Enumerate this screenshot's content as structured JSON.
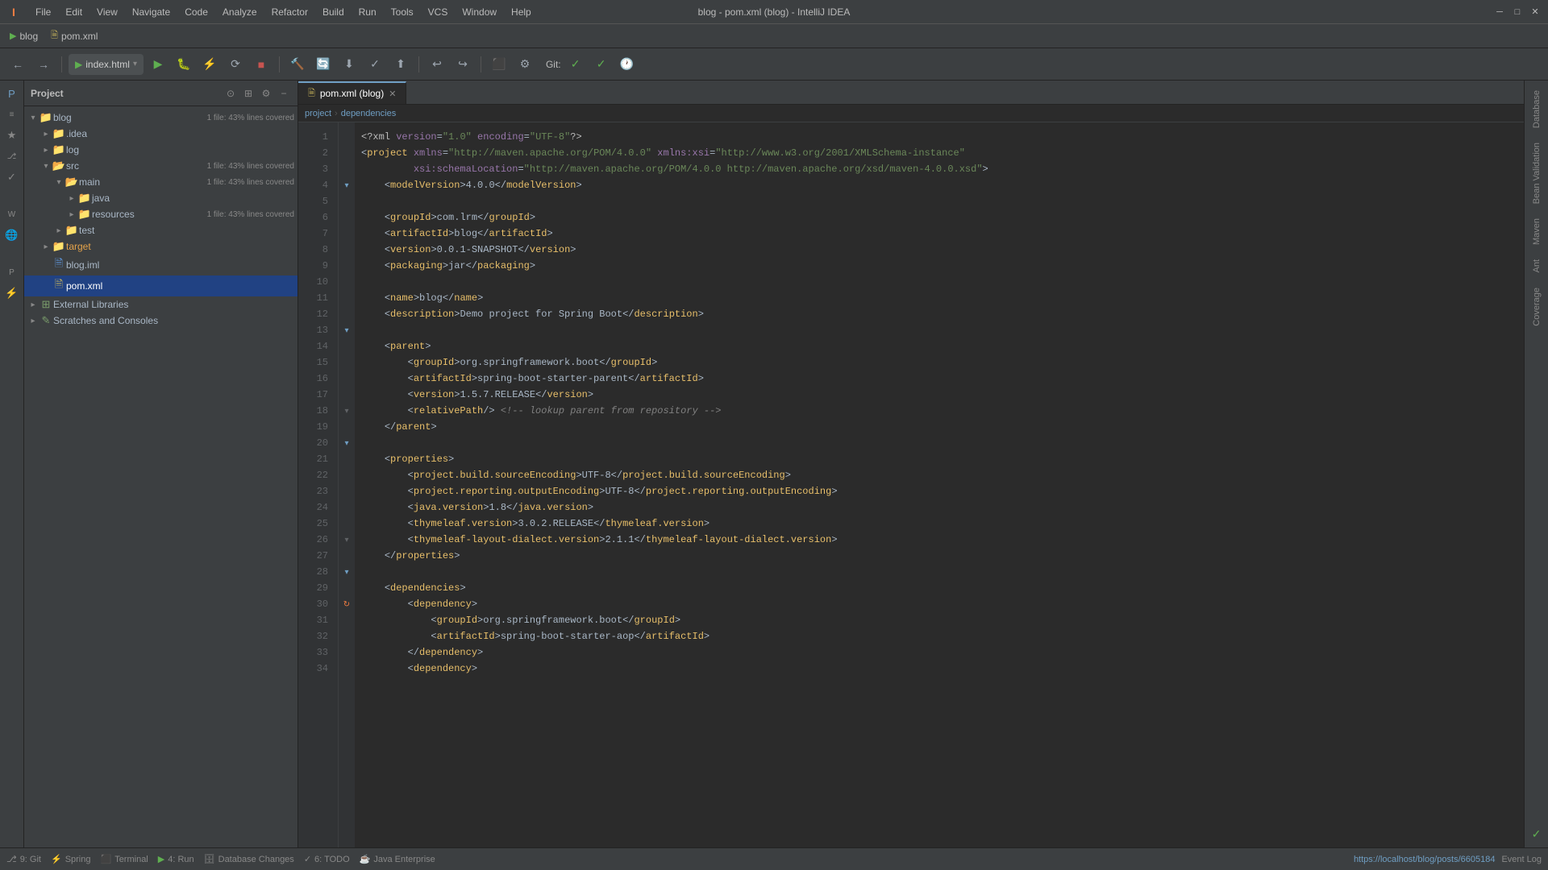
{
  "window": {
    "title": "blog - pom.xml (blog) - IntelliJ IDEA",
    "tab_blog": "blog",
    "tab_pom": "pom.xml"
  },
  "menus": {
    "items": [
      "File",
      "Edit",
      "View",
      "Navigate",
      "Code",
      "Analyze",
      "Refactor",
      "Build",
      "Run",
      "Tools",
      "VCS",
      "Window",
      "Help"
    ]
  },
  "toolbar": {
    "run_config": "index.html",
    "git_label": "Git:"
  },
  "project_panel": {
    "title": "Project",
    "root": "blog",
    "root_badge": "1 file: 43% lines covered",
    "nodes": [
      {
        "label": ".idea",
        "type": "folder",
        "indent": 1
      },
      {
        "label": "log",
        "type": "folder",
        "indent": 1
      },
      {
        "label": "src",
        "type": "folder-src",
        "indent": 1,
        "badge": "1 file: 43% lines covered"
      },
      {
        "label": "main",
        "type": "folder-main",
        "indent": 2,
        "badge": "1 file: 43% lines covered"
      },
      {
        "label": "java",
        "type": "folder",
        "indent": 3
      },
      {
        "label": "resources",
        "type": "folder",
        "indent": 3,
        "badge": "1 file: 43% lines covered"
      },
      {
        "label": "test",
        "type": "folder",
        "indent": 2
      },
      {
        "label": "target",
        "type": "folder-target",
        "indent": 1
      },
      {
        "label": "blog.iml",
        "type": "iml",
        "indent": 1
      },
      {
        "label": "pom.xml",
        "type": "pom",
        "indent": 1,
        "selected": true
      },
      {
        "label": "External Libraries",
        "type": "lib",
        "indent": 0
      },
      {
        "label": "Scratches and Consoles",
        "type": "scratch",
        "indent": 0
      }
    ]
  },
  "editor": {
    "tab_label": "pom.xml (blog)",
    "lines": [
      {
        "num": 1,
        "text": "<?xml version=\"1.0\" encoding=\"UTF-8\"?>"
      },
      {
        "num": 2,
        "text": "<project xmlns=\"http://maven.apache.org/POM/4.0.0\" xmlns:xsi=\"http://www.w3.org/2001/XMLSchema-instance\""
      },
      {
        "num": 3,
        "text": "         xsi:schemaLocation=\"http://maven.apache.org/POM/4.0.0 http://maven.apache.org/xsd/maven-4.0.0.xsd\">"
      },
      {
        "num": 4,
        "text": "    <modelVersion>4.0.0</modelVersion>"
      },
      {
        "num": 5,
        "text": ""
      },
      {
        "num": 6,
        "text": "    <groupId>com.lrm</groupId>"
      },
      {
        "num": 7,
        "text": "    <artifactId>blog</artifactId>"
      },
      {
        "num": 8,
        "text": "    <version>0.0.1-SNAPSHOT</version>"
      },
      {
        "num": 9,
        "text": "    <packaging>jar</packaging>"
      },
      {
        "num": 10,
        "text": ""
      },
      {
        "num": 11,
        "text": "    <name>blog</name>"
      },
      {
        "num": 12,
        "text": "    <description>Demo project for Spring Boot</description>"
      },
      {
        "num": 13,
        "text": ""
      },
      {
        "num": 14,
        "text": "    <parent>"
      },
      {
        "num": 15,
        "text": "        <groupId>org.springframework.boot</groupId>"
      },
      {
        "num": 16,
        "text": "        <artifactId>spring-boot-starter-parent</artifactId>"
      },
      {
        "num": 17,
        "text": "        <version>1.5.7.RELEASE</version>"
      },
      {
        "num": 18,
        "text": "        <relativePath/> <!-- lookup parent from repository -->"
      },
      {
        "num": 19,
        "text": "    </parent>"
      },
      {
        "num": 20,
        "text": ""
      },
      {
        "num": 21,
        "text": "    <properties>"
      },
      {
        "num": 22,
        "text": "        <project.build.sourceEncoding>UTF-8</project.build.sourceEncoding>"
      },
      {
        "num": 23,
        "text": "        <project.reporting.outputEncoding>UTF-8</project.reporting.outputEncoding>"
      },
      {
        "num": 24,
        "text": "        <java.version>1.8</java.version>"
      },
      {
        "num": 25,
        "text": "        <thymeleaf.version>3.0.2.RELEASE</thymeleaf.version>"
      },
      {
        "num": 26,
        "text": "        <thymeleaf-layout-dialect.version>2.1.1</thymeleaf-layout-dialect.version>"
      },
      {
        "num": 27,
        "text": "    </properties>"
      },
      {
        "num": 28,
        "text": ""
      },
      {
        "num": 29,
        "text": "    <dependencies>"
      },
      {
        "num": 30,
        "text": "        <dependency>"
      },
      {
        "num": 31,
        "text": "            <groupId>org.springframework.boot</groupId>"
      },
      {
        "num": 32,
        "text": "            <artifactId>spring-boot-starter-aop</artifactId>"
      },
      {
        "num": 33,
        "text": "        </dependency>"
      },
      {
        "num": 34,
        "text": "        <dependency>"
      }
    ]
  },
  "breadcrumb": {
    "items": [
      "project",
      "dependencies"
    ]
  },
  "bottom_bar": {
    "git_label": "9: Git",
    "spring_label": "Spring",
    "terminal_label": "Terminal",
    "run_label": "4: Run",
    "db_label": "Database Changes",
    "todo_label": "6: TODO",
    "java_label": "Java Enterprise",
    "url": "https://localhost/blog/posts/6605184",
    "event_log": "Event Log"
  },
  "right_tabs": [
    "Database",
    "Bean Validation",
    "Maven",
    "Ant",
    "Coverage"
  ]
}
